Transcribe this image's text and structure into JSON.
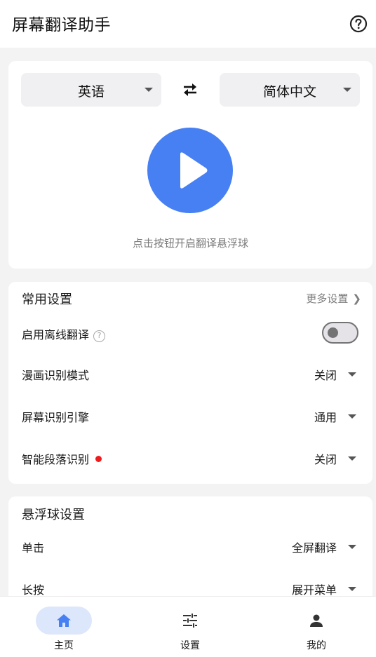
{
  "app": {
    "title": "屏幕翻译助手",
    "help_icon": "help-circle-icon"
  },
  "translate": {
    "source_language": "英语",
    "target_language": "简体中文",
    "swap_icon": "swap-arrows-icon",
    "play_icon": "play-icon",
    "hint": "点击按钮开启翻译悬浮球",
    "accent_color": "#4680f3"
  },
  "common_settings": {
    "title": "常用设置",
    "more_label": "更多设置",
    "offline": {
      "label": "启用离线翻译",
      "enabled": false
    },
    "comic_mode": {
      "label": "漫画识别模式",
      "value": "关闭"
    },
    "ocr_engine": {
      "label": "屏幕识别引擎",
      "value": "通用"
    },
    "smart_paragraph": {
      "label": "智能段落识别",
      "value": "关闭",
      "badge_color": "#ee1c1c"
    }
  },
  "float_settings": {
    "title": "悬浮球设置",
    "tap": {
      "label": "单击",
      "value": "全屏翻译"
    },
    "long_press": {
      "label": "长按",
      "value": "展开菜单"
    }
  },
  "bottom_nav": {
    "items": [
      {
        "label": "主页",
        "icon": "home-icon",
        "active": true
      },
      {
        "label": "设置",
        "icon": "sliders-icon",
        "active": false
      },
      {
        "label": "我的",
        "icon": "person-icon",
        "active": false
      }
    ],
    "active_color": "#4680f3"
  }
}
